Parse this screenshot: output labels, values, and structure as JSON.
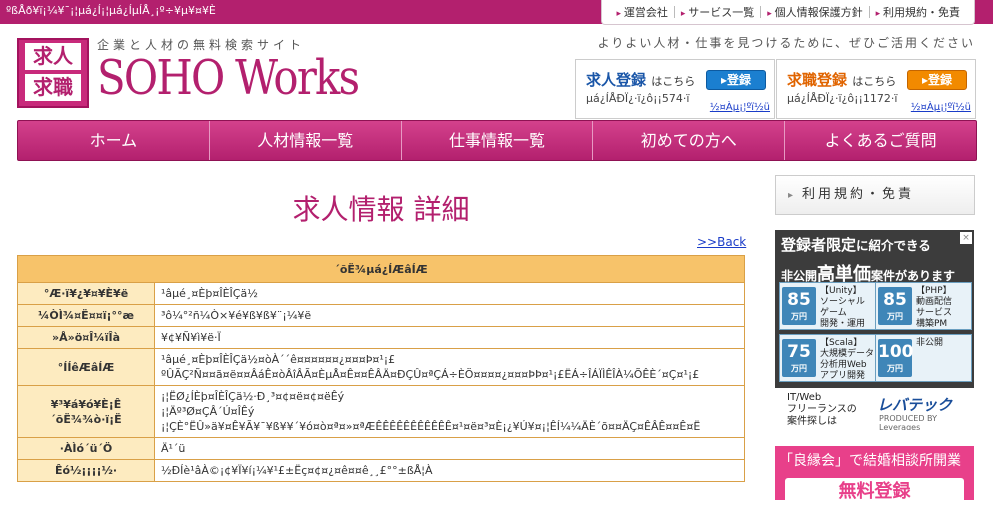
{
  "topbar": {
    "ticker": "ºßÅð¥ï¡¼¥¯¡¦µá¿Í¡¦µá¿ÍµÍÅ¸¡º÷¥µ¥¤¥È",
    "nav": [
      "運営会社",
      "サービス一覧",
      "個人情報保護方針",
      "利用規約・免責"
    ]
  },
  "logo": {
    "badge_top": "求人",
    "badge_bottom": "求職",
    "subtitle": "企業と人材の無料検索サイト",
    "name": "SOHO Works"
  },
  "tagline": "よりよい人材・仕事を見つけるために、ぜひご活用ください",
  "register": {
    "talent": {
      "title": "求人登録",
      "suffix": "はこちら",
      "button": "▸登録",
      "count": "µá¿ÍÅÐÏ¿·ï¿ô¡¡574·ï",
      "link": "½¤Àµ¡¦ºï½ü"
    },
    "job": {
      "title": "求職登録",
      "suffix": "はこちら",
      "button": "▸登録",
      "count": "µá¿ÍÅÐÏ¿·ï¿ô¡¡1172·ï",
      "link": "½¤Àµ¡¦ºï½ü"
    }
  },
  "mainnav": [
    "ホーム",
    "人材情報一覧",
    "仕事情報一覧",
    "初めての方へ",
    "よくあるご質問"
  ],
  "page_title": "求人情報 詳細",
  "back_link": ">>Back",
  "detail": {
    "caption": "´õË¾µá¿ÍÆâÍÆ",
    "rows": [
      {
        "label": "°Æ·ï¥¿¥¤¥È¥ë",
        "value": [
          "¹âµé¸¤Èþ¤ÎÈÎÇä½"
        ]
      },
      {
        "label": "¼ÒÌ¾¤Ë¤¤ï¡°°æ",
        "value": [
          "³ô¼°²ñ¼Ò×¥é¥ß¥ß¥¨¡¼¥ë"
        ]
      },
      {
        "label": "»Å»ö¤Î¼ïÎà",
        "value": [
          "¥¢¥Ñ¥ì¥ë·Ï"
        ]
      },
      {
        "label": "°ÍÍêÆâÍÆ",
        "value": [
          "¹âµé¸¤Èþ¤ÎÈÎÇä½¤òÀ´´ê¤¤¤¤¤¤¿¤¤¤Þ¤¹¡£",
          "ºÛÃÇ²Ñ¤¤ã¤ë¤¤ÂáÊ¤òÂîÂÃ¤ÈµÅ¤Ê¤¤ÊÂÄ¤ÐÇÛ¤ªÇÁ÷ÈÖ¤¤¤¤¿¤¤¤ÞÞ¤¹¡£ËÁ÷ÎÁÏÌÊÎÀ¼ÕÊÈ´¤Ç¤¹¡£"
        ]
      },
      {
        "label": "¥³¥á¥ó¥È¡Ê\n´õË¾¾ò·ï¡Ë",
        "value": [
          "¡¦ËØ¿ÍÈþ¤ÎÈÎÇä½·Ð¸³¤¢¤ë¤¢¤ëÊý",
          "¡¦Äº³Ø¤ÇÂ´Ú¤ÎÊý",
          "¡¦ÇÈ°ËÛ»ä¥¤Ê¥Ã¥¯¥ß¥¥´¥ó¤ò¤ª¤»¤ªÆÊÊÊÊÊÊÊÊÊÊÊ¤¹¤ë¤³¤È¡¿¥Ú¥¤¡¦ÊÍ¼¼ÄÈ´õ¤¤ÄÇ¤ÊÂÊ¤¤Ê¤Ë"
        ]
      },
      {
        "label": "·ÀÌó´ü´Ö",
        "value": [
          "Ä¹´ü"
        ]
      },
      {
        "label": "Êó½¡¡¡¡½·",
        "value": [
          "½ÐÍè¹âÀ©¡¢¥Ï¥í¡¼¥¹£±Ëç¤¢¤¿¤ê¤¤ê¸¸£°°±ßÅ¦À"
        ]
      }
    ]
  },
  "sidebar": {
    "link": "利用規約・免責",
    "ad": {
      "headline": "登録者限定",
      "headline_tail": "に紹介できる",
      "badge": "非公開",
      "sub_main": "高単価",
      "sub_tail": "案件があります",
      "tiles": [
        {
          "price": "85",
          "unit": "万円",
          "desc": "【Unity】\nソーシャル\nゲーム\n開発・運用"
        },
        {
          "price": "85",
          "unit": "万円",
          "desc": "【PHP】\n動画配信\nサービス\n構築PM"
        },
        {
          "price": "75",
          "unit": "万円",
          "desc": "【Scala】\n大規模データ\n分析用Web\nアプリ開発"
        },
        {
          "price": "100",
          "unit": "万円",
          "desc": "非公開"
        }
      ],
      "brand_left": "IT/Web\nフリーランスの\n案件探しは",
      "brand_name": "レバテック",
      "brand_sub": "PRODUCED BY Leverages"
    },
    "ad2": {
      "title": "「良縁会」で結婚相談所開業",
      "button": "無料登録"
    }
  },
  "colors": {
    "brand": "#b3206e",
    "accent_blue": "#1b7fd0",
    "accent_orange": "#f28a00",
    "table_head": "#f7c36a"
  }
}
